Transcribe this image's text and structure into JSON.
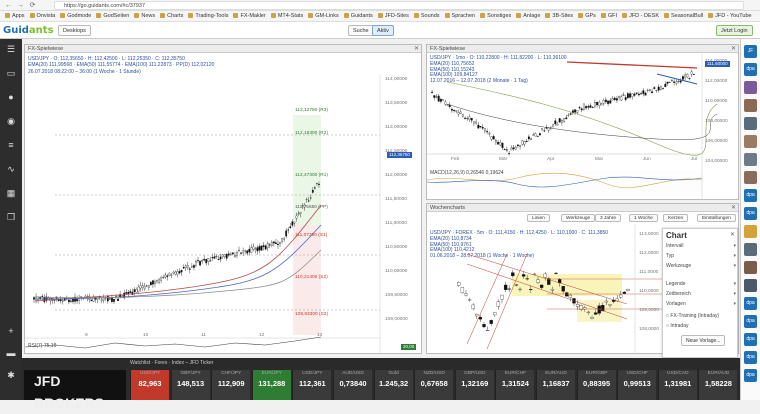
{
  "browser": {
    "url": "https://go.guidants.com/#c/37937",
    "nav_back": "←",
    "nav_forward": "→",
    "nav_reload": "⟳",
    "bookmarks": [
      "Apps",
      "Onvista",
      "Godmode",
      "GodSeiten",
      "News",
      "Charts",
      "Trading-Tools",
      "FX-Makler",
      "MT4-Stats",
      "GM-Links",
      "Guidants",
      "JFD-Sites",
      "Sounds",
      "Sprachen",
      "Sonstiges",
      "Anlage",
      "3B-Sites",
      "GPs",
      "GFI",
      "JFD - DESK",
      "SeasonalBull",
      "JFD - YouTube"
    ]
  },
  "topbar": {
    "logo_main": "Guid",
    "logo_accent": "ants",
    "desktop_label": "Desktops",
    "search_label": "Suche",
    "active_label": "Aktiv",
    "login_label": "Jetzt Login"
  },
  "chart1": {
    "title": "FX-Spielwiese",
    "info1": "USD/JPY · O: 112,35650 · H: 112,42500 · L: 112,25350 · C: 112,35750",
    "info2": "EMA(20) 111,99568 · EMA(50) 111,55774 · EMA(100) 111,22873 · PP(D) 112,02120",
    "info3": "26.07.2018 08:22:00 – 36:00 (1 Woche · 1 Stunde)",
    "rsi_label": "RSI(7)  75,19",
    "rsi_value": "20,00",
    "price_axis": [
      "114,00000",
      "113,50000",
      "113,00000",
      "112,50000",
      "112,00000",
      "111,50000",
      "111,00000",
      "110,50000",
      "110,00000",
      "109,50000",
      "109,00000"
    ],
    "price_current": "112,35750",
    "tags": [
      "113,12750 (R3)",
      "112,18300 (R2)",
      "112,47300 (R1)",
      "111,75650 (PP)",
      "111,07350 (S1)",
      "110,21400 (S2)",
      "109,93300 (S3)"
    ],
    "time_axis": [
      "9",
      "10",
      "11",
      "12",
      "13"
    ]
  },
  "chart2": {
    "title": "FX-Spielwiese",
    "info1": "USD/JPY · 1mo · O: 110,22800 · H: 111,82200 · L: 110,36100",
    "info2": "EMA(20) 110,75652",
    "info3": "EMA(50) 110,15243",
    "info4": "EMA(100) 109,84127",
    "info5": "12.07.2016 – 12.07.2018 (2 Monate · 1 Tag)",
    "macd_label": "MACD(12,26,9) 0,26546 0,19624",
    "price_axis": [
      "114,00000",
      "112,00000",
      "110,00000",
      "108,00000",
      "106,00000",
      "104,00000"
    ],
    "price_current": "111,50000",
    "time_axis": [
      "Feb",
      "Mär",
      "Apr",
      "Mai",
      "Jun",
      "Jul"
    ]
  },
  "chart3": {
    "title": "Wochencharts",
    "info1": "USD/JPY · FOREX · 5m · O: 111,4150 · H: 112,4250 · L: 110,1000 · C: 111,3850",
    "info2": "EMA(20) 110,8734",
    "info3": "EMA(50) 110,9761",
    "info4": "EMA(100) 110,4212",
    "info5": "01.06.2018 – 28.07.2018 (1 Woche · 1 Woche)",
    "toolbar": [
      "Linien",
      "Werkzeuge",
      "3 Jahre",
      "1 Woche",
      "Kerzen",
      "Einstellungen"
    ],
    "price_axis": [
      "113,5000",
      "112,0000",
      "111,0000",
      "110,0000",
      "109,0000",
      "108,0000"
    ]
  },
  "panel": {
    "title": "Chart",
    "rows": [
      "Intervall",
      "Typ",
      "Werkzeuge",
      "Legende",
      "Zeitbereich",
      "Vorlagen"
    ],
    "items": [
      "FX-Training (Intraday)",
      "Intraday"
    ],
    "new_template": "Neue Vorlage..."
  },
  "bottom": {
    "title": "Watchlist · Forex · Index – JFD Ticker",
    "broker": "JFD BROKERS",
    "tickers": [
      {
        "name": "USD/JPY",
        "value": "82,963",
        "color": "#c0392b"
      },
      {
        "name": "GBP/JPY",
        "value": "148,513",
        "color": "#3a3a3a"
      },
      {
        "name": "CHF/JPY",
        "value": "112,909",
        "color": "#3a3a3a"
      },
      {
        "name": "EUR/JPY",
        "value": "131,288",
        "color": "#2e7d32"
      },
      {
        "name": "USD/JPY",
        "value": "112,361",
        "color": "#3a3a3a"
      },
      {
        "name": "AUD/USD",
        "value": "0,73840",
        "color": "#3a3a3a"
      },
      {
        "name": "Gold",
        "value": "1.245,32",
        "color": "#3a3a3a"
      },
      {
        "name": "NZD/USD",
        "value": "0,67658",
        "color": "#3a3a3a"
      },
      {
        "name": "GBP/USD",
        "value": "1,32169",
        "color": "#3a3a3a"
      },
      {
        "name": "EUR/CHF",
        "value": "1,31524",
        "color": "#3a3a3a"
      },
      {
        "name": "EUR/AUD",
        "value": "1,16837",
        "color": "#3a3a3a"
      },
      {
        "name": "EUR/GBP",
        "value": "0,88395",
        "color": "#3a3a3a"
      },
      {
        "name": "USD/CHF",
        "value": "0,99513",
        "color": "#3a3a3a"
      },
      {
        "name": "USD/CAD",
        "value": "1,31981",
        "color": "#3a3a3a"
      },
      {
        "name": "EUR/AUD",
        "value": "1,58228",
        "color": "#3a3a3a"
      }
    ]
  },
  "colors": {
    "accent": "#1f6fb5",
    "bull": "#2e7d32",
    "bear": "#c0392b",
    "brand_green": "#7bbf2f"
  },
  "icons": [
    "menu-icon",
    "monitor-icon",
    "user-icon",
    "eye-icon",
    "list-icon",
    "chart-line-icon",
    "calendar-icon",
    "copy-icon",
    "plus-icon",
    "folder-icon",
    "gear-icon"
  ]
}
